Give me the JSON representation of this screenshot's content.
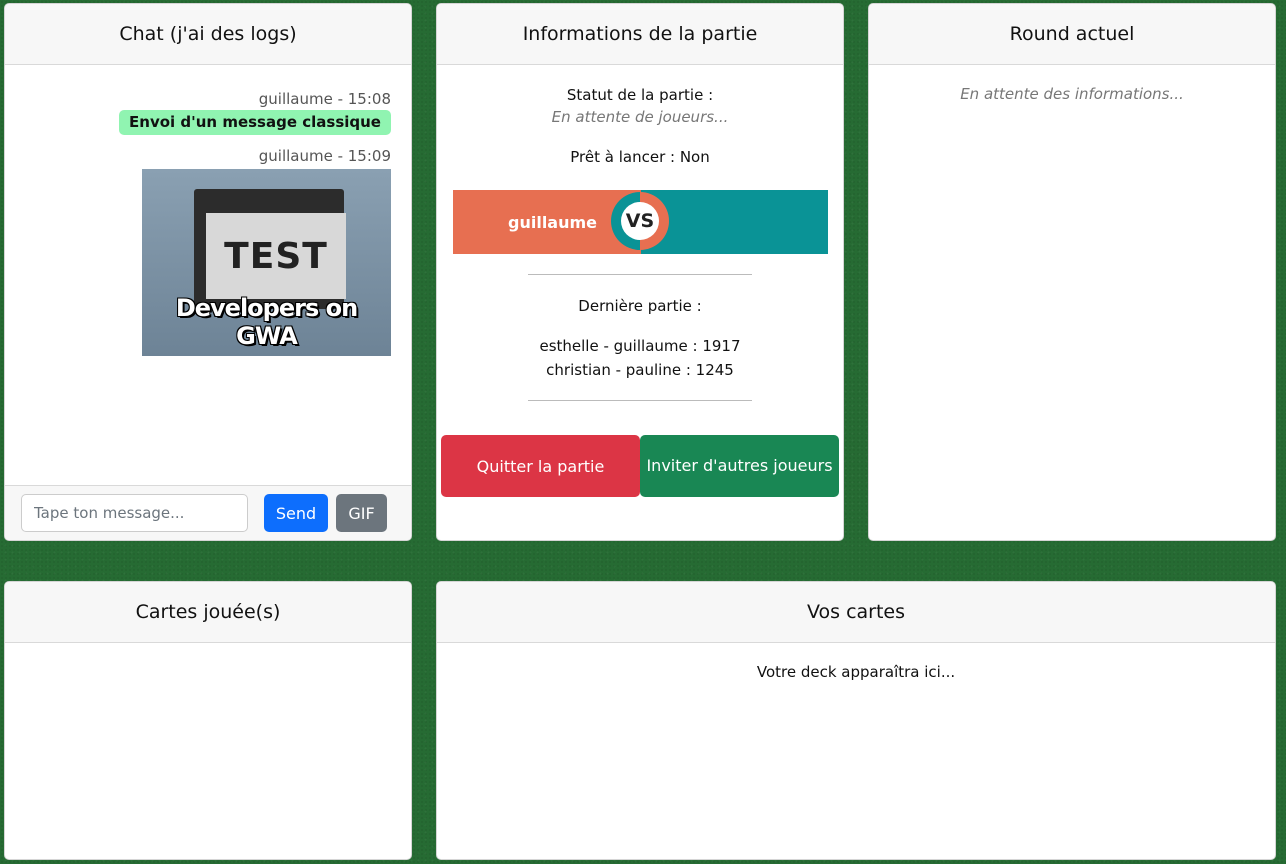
{
  "chat": {
    "title": "Chat (j'ai des logs)",
    "messages": [
      {
        "meta": "guillaume - 15:08",
        "text": "Envoi d'un message classique"
      },
      {
        "meta": "guillaume - 15:09",
        "gif_text": "TEST",
        "gif_caption": "Developers on GWA"
      }
    ],
    "input_placeholder": "Tape ton message...",
    "send_label": "Send",
    "gif_label": "GIF"
  },
  "info": {
    "title": "Informations de la partie",
    "status_label": "Statut de la partie :",
    "status_value": "En attente de joueurs...",
    "ready_line": "Prêt à lancer : Non",
    "player_left": "guillaume",
    "vs_label": "VS",
    "last_game_label": "Dernière partie :",
    "last_games": [
      "esthelle - guillaume : 1917",
      "christian - pauline : 1245"
    ],
    "quit_label": "Quitter la partie",
    "invite_label": "Inviter d'autres joueurs"
  },
  "round": {
    "title": "Round actuel",
    "waiting": "En attente des informations..."
  },
  "played": {
    "title": "Cartes jouée(s)"
  },
  "hand": {
    "title": "Vos cartes",
    "hint": "Votre deck apparaîtra ici..."
  },
  "colors": {
    "background": "#266b33",
    "player_left": "#e76f51",
    "player_right": "#0a9396",
    "send": "#0d6efd",
    "quit": "#dc3545",
    "invite": "#198754",
    "bubble": "#90f4b1"
  }
}
